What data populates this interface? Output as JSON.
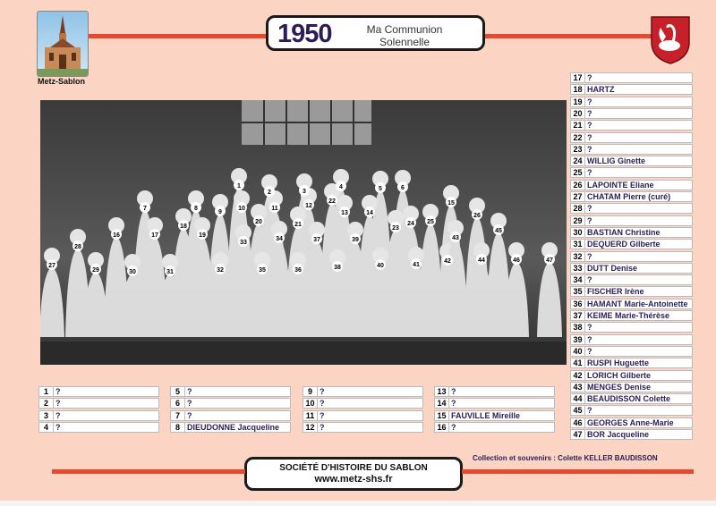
{
  "header": {
    "year": "1950",
    "title_line1": "Ma Communion",
    "title_line2": "Solennelle",
    "church_caption": "Metz-Sablon"
  },
  "photo": {
    "number_labels": [
      "1",
      "2",
      "3",
      "4",
      "5",
      "6",
      "7",
      "8",
      "9",
      "10",
      "11",
      "12",
      "13",
      "14",
      "15",
      "16",
      "17",
      "18",
      "19",
      "20",
      "21",
      "22",
      "23",
      "24",
      "25",
      "26",
      "27",
      "28",
      "29",
      "30",
      "31",
      "32",
      "33",
      "34",
      "35",
      "36",
      "37",
      "38",
      "39",
      "40",
      "41",
      "42",
      "43",
      "44",
      "45",
      "46",
      "47"
    ]
  },
  "names": [
    {
      "n": "1",
      "name": "?"
    },
    {
      "n": "2",
      "name": "?"
    },
    {
      "n": "3",
      "name": "?"
    },
    {
      "n": "4",
      "name": "?"
    },
    {
      "n": "5",
      "name": "?"
    },
    {
      "n": "6",
      "name": "?"
    },
    {
      "n": "7",
      "name": "?"
    },
    {
      "n": "8",
      "name": "DIEUDONNE Jacqueline"
    },
    {
      "n": "9",
      "name": "?"
    },
    {
      "n": "10",
      "name": "?"
    },
    {
      "n": "11",
      "name": "?"
    },
    {
      "n": "12",
      "name": "?"
    },
    {
      "n": "13",
      "name": "?"
    },
    {
      "n": "14",
      "name": "?"
    },
    {
      "n": "15",
      "name": "FAUVILLE Mireille"
    },
    {
      "n": "16",
      "name": "?"
    },
    {
      "n": "17",
      "name": "?"
    },
    {
      "n": "18",
      "name": "HARTZ"
    },
    {
      "n": "19",
      "name": "?"
    },
    {
      "n": "20",
      "name": "?"
    },
    {
      "n": "21",
      "name": "?"
    },
    {
      "n": "22",
      "name": "?"
    },
    {
      "n": "23",
      "name": "?"
    },
    {
      "n": "24",
      "name": "WILLIG Ginette"
    },
    {
      "n": "25",
      "name": "?"
    },
    {
      "n": "26",
      "name": "LAPOINTE Eliane"
    },
    {
      "n": "27",
      "name": "CHATAM Pierre (curé)"
    },
    {
      "n": "28",
      "name": "?"
    },
    {
      "n": "29",
      "name": "?"
    },
    {
      "n": "30",
      "name": "BASTIAN Christine"
    },
    {
      "n": "31",
      "name": "DEQUERD Gilberte"
    },
    {
      "n": "32",
      "name": "?"
    },
    {
      "n": "33",
      "name": "DUTT Denise"
    },
    {
      "n": "34",
      "name": "?"
    },
    {
      "n": "35",
      "name": "FISCHER Irène"
    },
    {
      "n": "36",
      "name": "HAMANT Marie-Antoinette"
    },
    {
      "n": "37",
      "name": "KEIME Marie-Thérèse"
    },
    {
      "n": "38",
      "name": "?"
    },
    {
      "n": "39",
      "name": "?"
    },
    {
      "n": "40",
      "name": "?"
    },
    {
      "n": "41",
      "name": "RUSPI Huguette"
    },
    {
      "n": "42",
      "name": "LORICH Gilberte"
    },
    {
      "n": "43",
      "name": "MENGES Denise"
    },
    {
      "n": "44",
      "name": "BEAUDISSON Colette"
    },
    {
      "n": "45",
      "name": "?"
    },
    {
      "n": "46",
      "name": "GEORGES Anne-Marie"
    },
    {
      "n": "47",
      "name": "BOR Jacqueline"
    }
  ],
  "footer": {
    "society": "SOCIÉTÉ D'HISTOIRE DU SABLON",
    "website": "www.metz-shs.fr",
    "credit": "Collection et souvenirs :  Colette KELLER BAUDISSON"
  },
  "colors": {
    "background": "#fcd4c4",
    "accent_bar": "#e64a2e",
    "name_text": "#2b1d58"
  }
}
